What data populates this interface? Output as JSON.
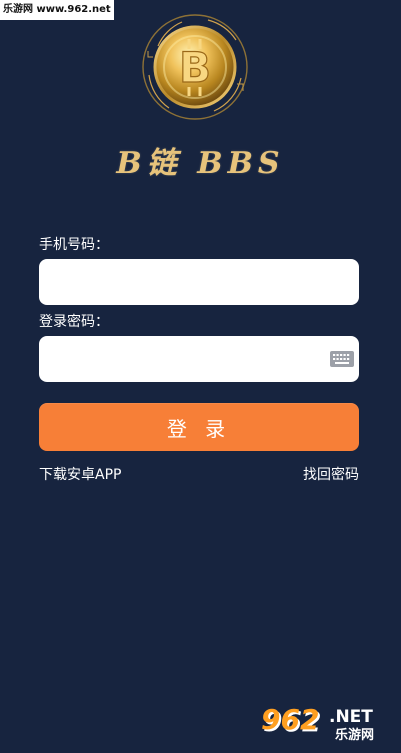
{
  "watermarks": {
    "top": "乐游网 www.962.net",
    "bottom_number": "962",
    "bottom_domain": ".NET",
    "bottom_site": "乐游网"
  },
  "branding": {
    "title": "B链 BBS",
    "coin_icon": "bitcoin-coin-icon",
    "colors": {
      "background": "#17243f",
      "gold": "#e7c37b",
      "button": "#f77f37",
      "input_background": "#ffffff"
    }
  },
  "form": {
    "phone_label": "手机号码：",
    "phone_value": "",
    "password_label": "登录密码：",
    "password_value": "",
    "keyboard_icon": "keyboard-icon",
    "login_button": "登 录"
  },
  "links": {
    "download": "下载安卓APP",
    "forgot_password": "找回密码"
  }
}
